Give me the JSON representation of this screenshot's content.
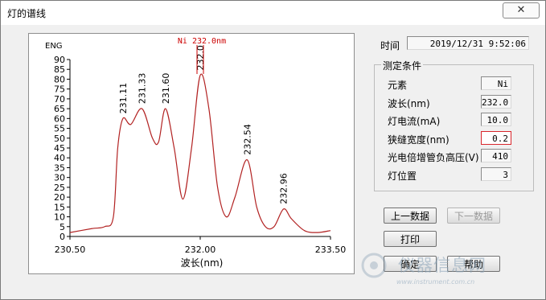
{
  "window": {
    "title": "灯的谱线"
  },
  "time": {
    "label": "时间",
    "value": "2019/12/31 9:52:06"
  },
  "conditions": {
    "title": "测定条件",
    "element": {
      "label": "元素",
      "value": "Ni"
    },
    "wavelength": {
      "label": "波长(nm)",
      "value": "232.0"
    },
    "lamp_current": {
      "label": "灯电流(mA)",
      "value": "10.0"
    },
    "slit_width": {
      "label": "狭缝宽度(nm)",
      "value": "0.2"
    },
    "pmt_voltage": {
      "label": "光电倍增管负高压(V)",
      "value": "410"
    },
    "lamp_position": {
      "label": "灯位置",
      "value": "3"
    }
  },
  "buttons": {
    "prev_data": "上一数据",
    "next_data": "下一数据",
    "print": "打印",
    "ok": "确定",
    "help": "帮助"
  },
  "watermark": {
    "text": "仪器信息网",
    "url": "www.instrument.com.cn"
  },
  "colors": {
    "trace": "#b22222",
    "marker": "#cc0000"
  },
  "chart_data": {
    "type": "line",
    "title": "Ni 232.0nm",
    "ylabel": "ENG",
    "xlabel": "波长(nm)",
    "xlim": [
      230.5,
      233.5
    ],
    "ylim": [
      0,
      90
    ],
    "xticks": [
      "230.50",
      "232.00",
      "233.50"
    ],
    "yticks": [
      0,
      5,
      10,
      15,
      20,
      25,
      30,
      35,
      40,
      45,
      50,
      55,
      60,
      65,
      70,
      75,
      80,
      85,
      90
    ],
    "grid": false,
    "series": [
      {
        "x": [
          230.5,
          230.75,
          230.9,
          231.0,
          231.05,
          231.11,
          231.2,
          231.33,
          231.45,
          231.52,
          231.6,
          231.7,
          231.8,
          231.9,
          232.0,
          232.1,
          232.2,
          232.3,
          232.4,
          232.54,
          232.65,
          232.75,
          232.85,
          232.96,
          233.05,
          233.2,
          233.35,
          233.5
        ],
        "y": [
          2,
          4,
          5,
          10,
          45,
          60,
          57,
          65,
          50,
          48,
          65,
          45,
          19,
          45,
          82,
          65,
          25,
          10,
          20,
          39,
          15,
          5,
          5,
          14,
          9,
          3,
          2,
          3
        ]
      }
    ],
    "peak_labels": [
      {
        "x": 231.11,
        "text": "231.11"
      },
      {
        "x": 231.33,
        "text": "231.33"
      },
      {
        "x": 231.6,
        "text": "231.60"
      },
      {
        "x": 232.0,
        "text": "232.0"
      },
      {
        "x": 232.54,
        "text": "232.54"
      },
      {
        "x": 232.96,
        "text": "232.96"
      }
    ]
  }
}
